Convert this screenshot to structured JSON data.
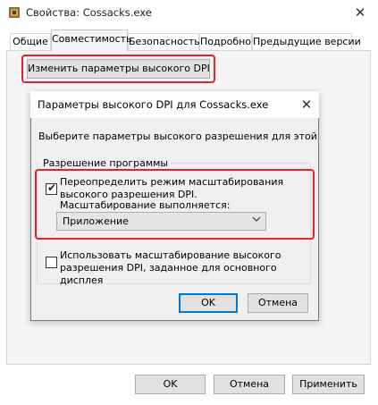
{
  "window": {
    "title": "Свойства: Cossacks.exe",
    "close_glyph": "✕",
    "icon": "app-icon"
  },
  "tabs": [
    {
      "label": "Общие"
    },
    {
      "label": "Совместимость",
      "active": true
    },
    {
      "label": "Безопасность"
    },
    {
      "label": "Подробно"
    },
    {
      "label": "Предыдущие версии"
    }
  ],
  "compat": {
    "change_dpi_label": "Изменить параметры высокого DPI"
  },
  "dialog": {
    "title": "Параметры высокого DPI для Cossacks.exe",
    "close_glyph": "✕",
    "description": "Выберите параметры высокого разрешения для этой",
    "group_title": "Разрешение программы",
    "override_checkbox": {
      "checked": true,
      "label": "Переопределить режим масштабирования высокого разрешения DPI."
    },
    "scaling_label": "Масштабирование выполняется:",
    "scaling_select": {
      "value": "Приложение",
      "chevron": "⌄"
    },
    "system_checkbox": {
      "checked": false,
      "label": "Использовать масштабирование высокого разрешения DPI, заданное для основного дисплея"
    },
    "ok_label": "OK",
    "cancel_label": "Отмена"
  },
  "footer": {
    "ok_label": "OK",
    "cancel_label": "Отмена",
    "apply_label": "Применить"
  },
  "colors": {
    "highlight": "#e5212e",
    "focus_border": "#0078d7",
    "dialog_bg": "#f0f0f0",
    "button_bg": "#e1e1e1"
  }
}
